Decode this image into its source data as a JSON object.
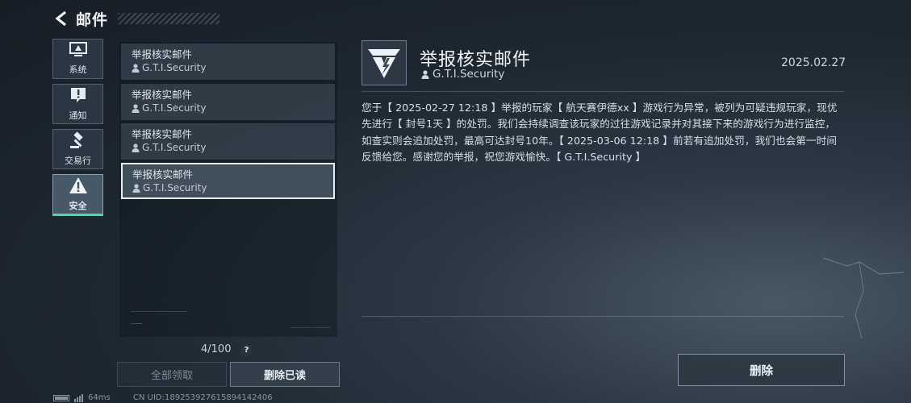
{
  "header": {
    "title": "邮件",
    "back_icon": "back-arrow-icon"
  },
  "categories": [
    {
      "label": "系统",
      "icon": "monitor-icon",
      "active": false
    },
    {
      "label": "通知",
      "icon": "alert-bubble-icon",
      "active": false
    },
    {
      "label": "交易行",
      "icon": "gavel-icon",
      "active": false
    },
    {
      "label": "安全",
      "icon": "warning-triangle-icon",
      "active": true
    }
  ],
  "mail_list": [
    {
      "subject": "举报核实邮件",
      "sender": "G.T.I.Security",
      "selected": false
    },
    {
      "subject": "举报核实邮件",
      "sender": "G.T.I.Security",
      "selected": false
    },
    {
      "subject": "举报核实邮件",
      "sender": "G.T.I.Security",
      "selected": false
    },
    {
      "subject": "举报核实邮件",
      "sender": "G.T.I.Security",
      "selected": true
    }
  ],
  "mail_count": "4/100",
  "help_label": "?",
  "buttons": {
    "claim_all": "全部领取",
    "delete_read": "删除已读",
    "delete": "删除"
  },
  "status_bar": {
    "ping": "64ms",
    "uid": "CN UID:189253927615894142406"
  },
  "detail": {
    "title": "举报核实邮件",
    "sender": "G.T.I.Security",
    "date": "2025.02.27",
    "body": "您于【 2025-02-27 12:18 】举报的玩家【 航天赛伊德xx 】游戏行为异常，被列为可疑违规玩家，现优先进行【 封号1天 】的处罚。我们会持续调查该玩家的过往游戏记录并对其接下来的游戏行为进行监控，如查实则会追加处罚，最高可达封号10年。【 2025-03-06 12:18 】前若有追加处罚，我们也会第一时间反馈给您。感谢您的举报，祝您游戏愉快。【 G.T.I.Security 】"
  },
  "colors": {
    "accent": "#3ee0a6",
    "background": "#1e2832"
  }
}
